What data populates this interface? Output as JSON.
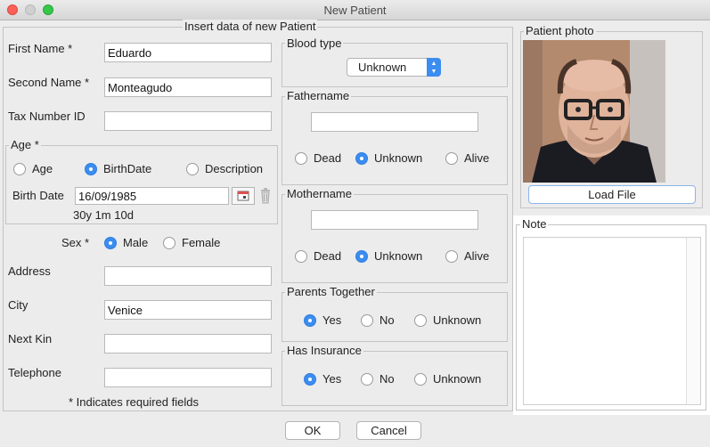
{
  "window": {
    "title": "New Patient"
  },
  "insert_group": {
    "title": "Insert data of new Patient"
  },
  "fields": {
    "first_name": {
      "label": "First Name *",
      "value": "Eduardo"
    },
    "second_name": {
      "label": "Second Name *",
      "value": "Monteagudo"
    },
    "tax_number": {
      "label": "Tax Number ID",
      "value": ""
    },
    "address": {
      "label": "Address",
      "value": ""
    },
    "city": {
      "label": "City",
      "value": "Venice"
    },
    "next_kin": {
      "label": "Next Kin",
      "value": ""
    },
    "telephone": {
      "label": "Telephone",
      "value": ""
    }
  },
  "age": {
    "title": "Age *",
    "options": [
      "Age",
      "BirthDate",
      "Description"
    ],
    "selected": "BirthDate",
    "birth_date_label": "Birth Date",
    "birth_date_value": "16/09/1985",
    "computed_age": "30y 1m 10d"
  },
  "sex": {
    "label": "Sex *",
    "options": [
      "Male",
      "Female"
    ],
    "selected": "Male"
  },
  "required_note": "* Indicates required fields",
  "blood_type": {
    "title": "Blood type",
    "value": "Unknown"
  },
  "fathername": {
    "title": "Fathername",
    "value": "",
    "options": [
      "Dead",
      "Unknown",
      "Alive"
    ],
    "selected": "Unknown"
  },
  "mothername": {
    "title": "Mothername",
    "value": "",
    "options": [
      "Dead",
      "Unknown",
      "Alive"
    ],
    "selected": "Unknown"
  },
  "parents_together": {
    "title": "Parents Together",
    "options": [
      "Yes",
      "No",
      "Unknown"
    ],
    "selected": "Yes"
  },
  "has_insurance": {
    "title": "Has Insurance",
    "options": [
      "Yes",
      "No",
      "Unknown"
    ],
    "selected": "Yes"
  },
  "photo": {
    "title": "Patient photo",
    "load_button": "Load File"
  },
  "note": {
    "title": "Note",
    "value": ""
  },
  "footer": {
    "ok": "OK",
    "cancel": "Cancel"
  },
  "colors": {
    "accent": "#3b8df0",
    "background": "#ececec"
  }
}
